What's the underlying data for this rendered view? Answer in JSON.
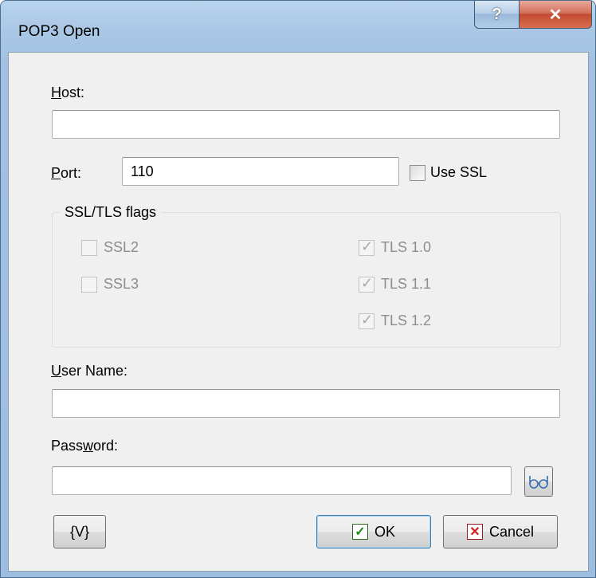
{
  "window": {
    "title": "POP3 Open"
  },
  "titlebar": {
    "help_glyph": "?",
    "close_glyph": "✕"
  },
  "host": {
    "label_key": "H",
    "label_rest": "ost:",
    "value": ""
  },
  "port": {
    "label_key": "P",
    "label_rest": "ort:",
    "value": "110"
  },
  "use_ssl": {
    "label": "Use SSL",
    "checked": false
  },
  "ssl_flags": {
    "title": "SSL/TLS flags",
    "ssl2": {
      "label": "SSL2",
      "checked": false
    },
    "ssl3": {
      "label": "SSL3",
      "checked": false
    },
    "tls10": {
      "label": "TLS 1.0",
      "checked": true
    },
    "tls11": {
      "label": "TLS 1.1",
      "checked": true
    },
    "tls12": {
      "label": "TLS 1.2",
      "checked": true
    }
  },
  "username": {
    "label_key": "U",
    "label_rest": "ser Name:",
    "value": ""
  },
  "password": {
    "label_pre": "Pass",
    "label_key": "w",
    "label_rest": "ord:",
    "value": ""
  },
  "buttons": {
    "variables": "{V}",
    "ok": "OK",
    "cancel": "Cancel"
  },
  "icons": {
    "show_password": "glasses-icon",
    "ok": "checkmark-icon",
    "cancel": "x-icon"
  }
}
